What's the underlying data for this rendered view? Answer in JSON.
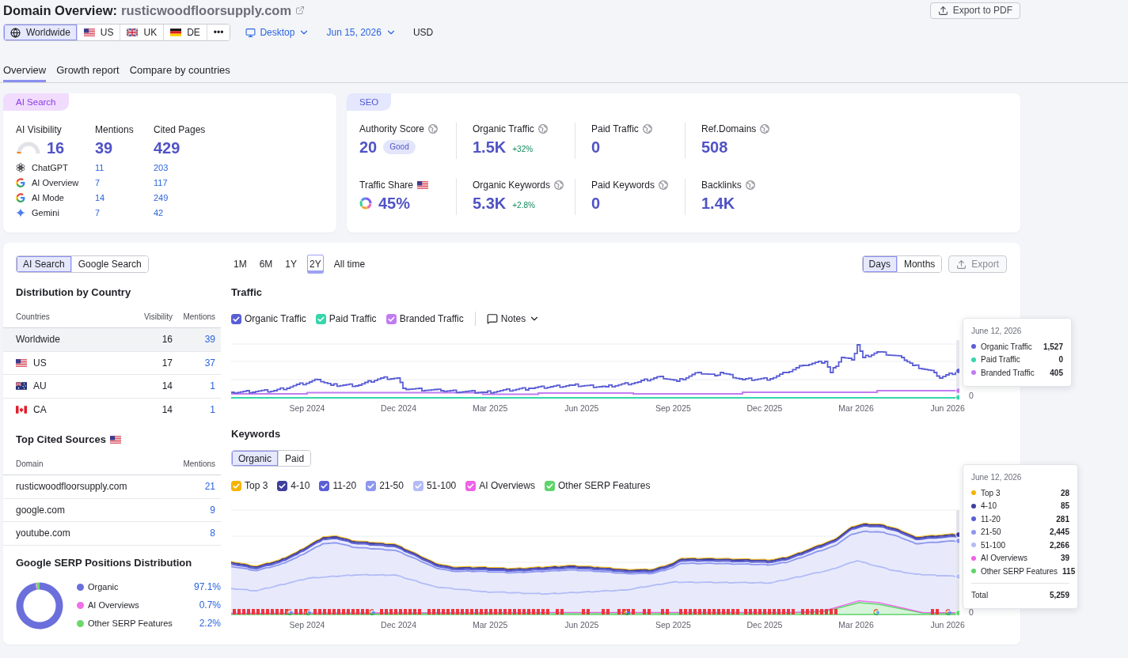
{
  "header": {
    "title": "Domain Overview:",
    "domain": "rusticwoodfloorsupply.com",
    "export_button": "Export to PDF"
  },
  "regions": [
    {
      "label": "Worldwide",
      "selected": true
    },
    {
      "label": "US",
      "selected": false
    },
    {
      "label": "UK",
      "selected": false
    },
    {
      "label": "DE",
      "selected": false
    }
  ],
  "more_button": "•••",
  "device": "Desktop",
  "date": "Jun 15, 2026",
  "currency": "USD",
  "tabs": [
    {
      "label": "Overview",
      "selected": true
    },
    {
      "label": "Growth report",
      "selected": false
    },
    {
      "label": "Compare by countries",
      "selected": false
    }
  ],
  "ai_search": {
    "tag": "AI Search",
    "columns": [
      "AI Visibility",
      "Mentions",
      "Cited Pages"
    ],
    "visibility": {
      "value": "16",
      "level": 0.05
    },
    "mentions": "39",
    "cited_pages": "429",
    "platforms": [
      {
        "name": "ChatGPT",
        "mentions": "11",
        "cited_pages": "203"
      },
      {
        "name": "AI Overview",
        "mentions": "7",
        "cited_pages": "117"
      },
      {
        "name": "AI Mode",
        "mentions": "14",
        "cited_pages": "249"
      },
      {
        "name": "Gemini",
        "mentions": "7",
        "cited_pages": "42"
      }
    ]
  },
  "seo": {
    "tag": "SEO",
    "metrics": [
      {
        "kind": "count",
        "label": "Authority Score",
        "value": "20",
        "badge": "Good"
      },
      {
        "kind": "count",
        "label": "Organic Traffic",
        "value": "1.5K",
        "change": "+32%"
      },
      {
        "kind": "count",
        "label": "Paid Traffic",
        "value": "0"
      },
      {
        "kind": "count",
        "label": "Ref.Domains",
        "value": "508"
      },
      {
        "kind": "share",
        "label": "Traffic Share",
        "value": "45%"
      },
      {
        "kind": "count",
        "label": "Organic Keywords",
        "value": "5.3K",
        "change": "+2.8%"
      },
      {
        "kind": "count",
        "label": "Paid Keywords",
        "value": "0"
      },
      {
        "kind": "count",
        "label": "Backlinks",
        "value": "1.4K"
      }
    ]
  },
  "source_toggle": [
    {
      "label": "AI Search",
      "selected": true
    },
    {
      "label": "Google Search",
      "selected": false
    }
  ],
  "country_distribution": {
    "title": "Distribution by Country",
    "columns": [
      "Countries",
      "Visibility",
      "Mentions"
    ],
    "rows": [
      {
        "country": "Worldwide",
        "visibility": "16",
        "mentions": "39",
        "selected": true
      },
      {
        "country": "US",
        "visibility": "17",
        "mentions": "37",
        "selected": false
      },
      {
        "country": "AU",
        "visibility": "14",
        "mentions": "1",
        "selected": false
      },
      {
        "country": "CA",
        "visibility": "14",
        "mentions": "1",
        "selected": false
      }
    ]
  },
  "top_cited_sources": {
    "title": "Top Cited Sources",
    "columns": [
      "Domain",
      "Mentions"
    ],
    "rows": [
      {
        "domain": "rusticwoodfloorsupply.com",
        "mentions": "21"
      },
      {
        "domain": "google.com",
        "mentions": "9"
      },
      {
        "domain": "youtube.com",
        "mentions": "8"
      }
    ]
  },
  "serp_distribution": {
    "title": "Google SERP Positions Distribution",
    "legend": [
      {
        "value": "97.1%",
        "color": "#6b6fdc"
      },
      {
        "value": "0.7%",
        "color": "#f070e8"
      },
      {
        "value": "2.2%",
        "color": "#6cd86c"
      }
    ],
    "chart_data": {
      "type": "donut",
      "categories": [
        "Organic",
        "AI Overviews",
        "Other SERP Features"
      ],
      "values": [
        97.1,
        0.7,
        2.2
      ]
    }
  },
  "periods": [
    {
      "label": "1M",
      "selected": false
    },
    {
      "label": "6M",
      "selected": false
    },
    {
      "label": "1Y",
      "selected": false
    },
    {
      "label": "2Y",
      "selected": true
    },
    {
      "label": "All time",
      "selected": false
    }
  ],
  "granularity": [
    {
      "label": "Days",
      "selected": true
    },
    {
      "label": "Months",
      "selected": false
    }
  ],
  "chart_export_button": "Export",
  "traffic": {
    "title": "Traffic",
    "series": [
      {
        "label": "Organic Traffic",
        "checked": true,
        "color": "#5b5fd6"
      },
      {
        "label": "Paid Traffic",
        "checked": true,
        "color": "#35d6ab"
      },
      {
        "label": "Branded Traffic",
        "checked": true,
        "color": "#c07cf2"
      }
    ],
    "notes_button": "Notes",
    "x_labels": [
      "Sep 2024",
      "Dec 2024",
      "Mar 2025",
      "Jun 2025",
      "Sep 2025",
      "Dec 2025",
      "Mar 2026",
      "Jun 2026"
    ],
    "y_labels": [
      "0"
    ],
    "tooltip": {
      "date": "June 12, 2026",
      "rows": [
        {
          "label": "Organic Traffic",
          "value": "1,527"
        },
        {
          "label": "Paid Traffic",
          "value": "0"
        },
        {
          "label": "Branded Traffic",
          "value": "405"
        }
      ]
    }
  },
  "keywords": {
    "title": "Keywords",
    "toggle": [
      {
        "label": "Organic",
        "selected": true
      },
      {
        "label": "Paid",
        "selected": false
      }
    ],
    "series": [
      {
        "label": "Top 3",
        "checked": true,
        "color": "#f5b400"
      },
      {
        "label": "4-10",
        "checked": true,
        "color": "#3f3f9c"
      },
      {
        "label": "11-20",
        "checked": true,
        "color": "#5b5fd6"
      },
      {
        "label": "21-50",
        "checked": true,
        "color": "#8d97ee"
      },
      {
        "label": "51-100",
        "checked": true,
        "color": "#b3bcf6"
      },
      {
        "label": "AI Overviews",
        "checked": true,
        "color": "#ee62e6"
      },
      {
        "label": "Other SERP Features",
        "checked": true,
        "color": "#5fd46b"
      }
    ],
    "x_labels": [
      "Sep 2024",
      "Dec 2024",
      "Mar 2025",
      "Jun 2025",
      "Sep 2025",
      "Dec 2025",
      "Mar 2026",
      "Jun 2026"
    ],
    "y_labels": [
      "0"
    ],
    "tooltip": {
      "date": "June 12, 2026",
      "rows": [
        {
          "label": "Top 3",
          "value": "28"
        },
        {
          "label": "4-10",
          "value": "85"
        },
        {
          "label": "11-20",
          "value": "281"
        },
        {
          "label": "21-50",
          "value": "2,445"
        },
        {
          "label": "51-100",
          "value": "2,266"
        },
        {
          "label": "AI Overviews",
          "value": "39"
        },
        {
          "label": "Other SERP Features",
          "value": "115"
        }
      ],
      "total_label": "Total",
      "total": "5,259"
    }
  }
}
